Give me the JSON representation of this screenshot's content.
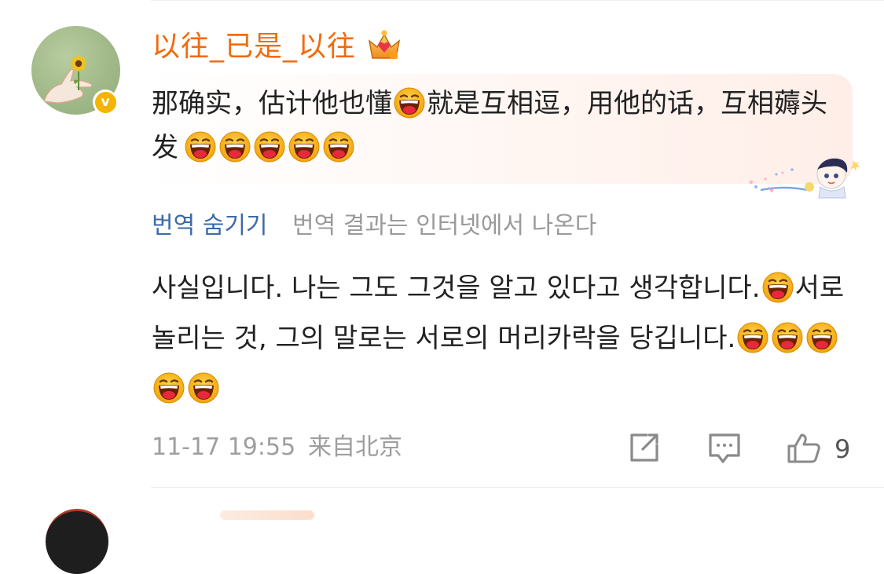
{
  "comment": {
    "username": "以往_已是_以往",
    "verified": true,
    "text_part1": "那确实，估计他也懂",
    "text_part2": "就是互相逗，用他的话，互相薅头发",
    "emoji_name": "laughing-face-emoji",
    "trailing_emoji_count": 5
  },
  "translation": {
    "toggle_label": "번역 숨기기",
    "source_note": "번역 결과는 인터넷에서 나온다",
    "text_part1": "사실입니다. 나는 그도 그것을 알고 있다고 생각합니다.",
    "text_part2": "서로 놀리는 것, 그의 말로는 서로의 머리카락을 당깁니다.",
    "trailing_emoji_count": 5
  },
  "meta": {
    "timestamp": "11-17 19:55",
    "location": "来自北京"
  },
  "actions": {
    "share_icon": "share-icon",
    "reply_icon": "comment-icon",
    "like_icon": "thumbs-up-icon",
    "like_count": "9"
  },
  "colors": {
    "username": "#f26b0d",
    "link": "#3d6aa7",
    "muted": "#9e9e9e",
    "verified_badge": "#f5b400"
  }
}
